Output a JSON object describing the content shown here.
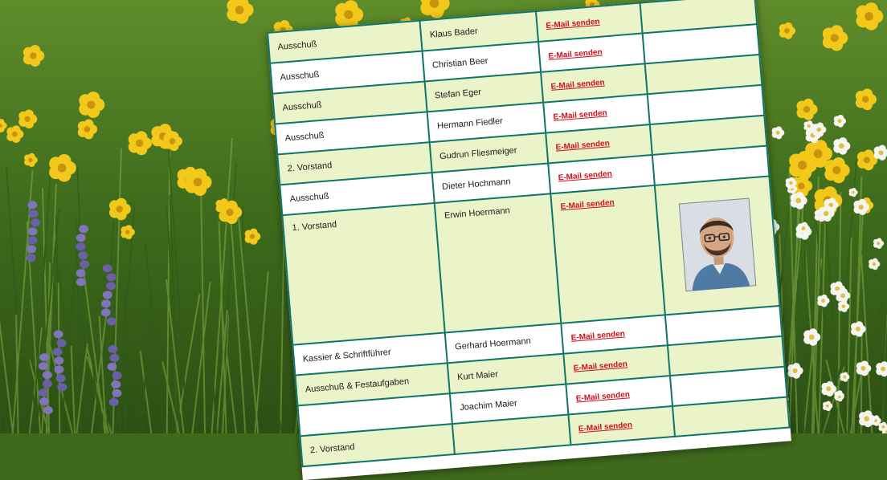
{
  "roster": {
    "rows": [
      {
        "role": "Ausschuß",
        "name": "Klaus Bader",
        "mail": "E-Mail senden"
      },
      {
        "role": "Ausschuß",
        "name": "Christian Beer",
        "mail": "E-Mail senden"
      },
      {
        "role": "Ausschuß",
        "name": "Stefan Eger",
        "mail": "E-Mail senden"
      },
      {
        "role": "Ausschuß",
        "name": "Hermann Fiedler",
        "mail": "E-Mail senden"
      },
      {
        "role": "2. Vorstand",
        "name": "Gudrun Fliesmeiger",
        "mail": "E-Mail senden"
      },
      {
        "role": "Ausschuß",
        "name": "Dieter Hochmann",
        "mail": "E-Mail senden"
      },
      {
        "role": "1. Vorstand",
        "name": "Erwin Hoermann",
        "mail": "E-Mail senden"
      },
      {
        "role": "Kassier & Schriftführer",
        "name": "Gerhard Hoermann",
        "mail": "E-Mail senden"
      },
      {
        "role": "Ausschuß & Festaufgaben",
        "name": "Kurt Maier",
        "mail": "E-Mail senden"
      },
      {
        "role": "",
        "name": "Joachim Maier",
        "mail": "E-Mail senden"
      },
      {
        "role": "2. Vorstand",
        "name": "",
        "mail": "E-Mail senden"
      }
    ]
  },
  "colors": {
    "table_border": "#0f7468",
    "row_tint": "#eaf4c8",
    "mail_link": "#d0101a"
  },
  "icons": {
    "photo": "portrait-photo"
  }
}
